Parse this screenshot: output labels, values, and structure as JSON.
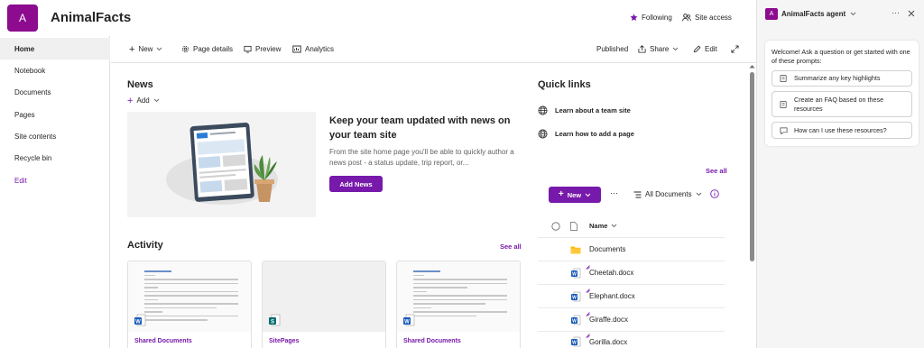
{
  "header": {
    "logo_letter": "A",
    "site_title": "AnimalFacts",
    "following_label": "Following",
    "site_access_label": "Site access"
  },
  "nav": {
    "items": [
      {
        "label": "Home"
      },
      {
        "label": "Notebook"
      },
      {
        "label": "Documents"
      },
      {
        "label": "Pages"
      },
      {
        "label": "Site contents"
      },
      {
        "label": "Recycle bin"
      },
      {
        "label": "Edit"
      }
    ]
  },
  "command_bar": {
    "new_label": "New",
    "page_details_label": "Page details",
    "preview_label": "Preview",
    "analytics_label": "Analytics",
    "status_label": "Published",
    "share_label": "Share",
    "edit_label": "Edit"
  },
  "news": {
    "title": "News",
    "add_label": "Add",
    "headline": "Keep your team updated with news on your team site",
    "description": "From the site home page you'll be able to quickly author a news post - a status update, trip report, or...",
    "add_news_label": "Add News"
  },
  "activity": {
    "title": "Activity",
    "see_all_label": "See all",
    "cards": [
      {
        "label": "Shared Documents"
      },
      {
        "label": "SitePages"
      },
      {
        "label": "Shared Documents"
      }
    ]
  },
  "quick_links": {
    "title": "Quick links",
    "items": [
      {
        "label": "Learn about a team site"
      },
      {
        "label": "Learn how to add a page"
      }
    ],
    "see_all_label": "See all"
  },
  "library": {
    "new_label": "New",
    "more_label": "···",
    "view_label": "All Documents",
    "name_header": "Name",
    "rows": [
      {
        "name": "Documents",
        "type": "folder"
      },
      {
        "name": "Cheetah.docx",
        "type": "word"
      },
      {
        "name": "Elephant.docx",
        "type": "word"
      },
      {
        "name": "Giraffe.docx",
        "type": "word"
      },
      {
        "name": "Gorilla.docx",
        "type": "word"
      }
    ]
  },
  "agent": {
    "logo_letter": "A",
    "title": "AnimalFacts agent",
    "welcome": "Welcome! Ask a question or get started with one of these prompts:",
    "prompts": [
      {
        "label": "Summarize any key highlights"
      },
      {
        "label": "Create an FAQ based on these resources"
      },
      {
        "label": "How can I use these resources?"
      }
    ]
  },
  "colors": {
    "accent": "#7719aa",
    "logo": "#8c0b8f",
    "word_blue": "#185abd",
    "folder_yellow": "#ffb900"
  }
}
